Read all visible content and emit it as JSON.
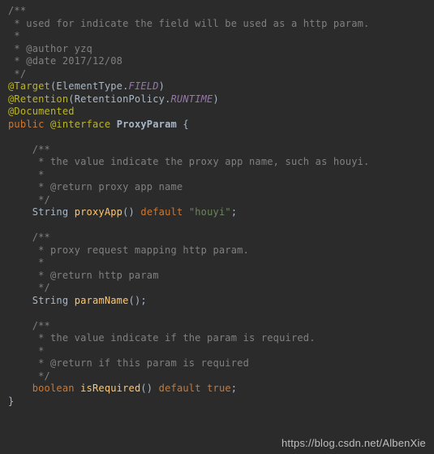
{
  "doc": {
    "start": "/**",
    "l1": " * used for indicate the field will be used as a http param.",
    "l2": " *",
    "l3": " * @author yzq",
    "l4": " * @date 2017/12/08",
    "end": " */"
  },
  "anno": {
    "target": "@Target",
    "target_paren_open": "(",
    "target_class": "ElementType",
    "target_dot": ".",
    "target_const": "FIELD",
    "target_paren_close": ")",
    "retention": "@Retention",
    "retention_paren_open": "(",
    "retention_class": "RetentionPolicy",
    "retention_dot": ".",
    "retention_const": "RUNTIME",
    "retention_paren_close": ")",
    "documented": "@Documented"
  },
  "decl": {
    "public": "public",
    "iface_kw": "@interface",
    "name": "ProxyParam",
    "open": "{",
    "close": "}"
  },
  "proxyApp": {
    "d0": "/**",
    "d1": " * the value indicate the proxy app name, such as houyi.",
    "d2": " *",
    "d3": " * @return proxy app name",
    "d4": " */",
    "type": "String",
    "name": "proxyApp",
    "parens": "()",
    "default_kw": "default",
    "value": "\"houyi\"",
    "semi": ";"
  },
  "paramName": {
    "d0": "/**",
    "d1": " * proxy request mapping http param.",
    "d2": " *",
    "d3": " * @return http param",
    "d4": " */",
    "type": "String",
    "name": "paramName",
    "parens": "()",
    "semi": ";"
  },
  "isRequired": {
    "d0": "/**",
    "d1": " * the value indicate if the param is required.",
    "d2": " *",
    "d3": " * @return if this param is required",
    "d4": " */",
    "type": "boolean",
    "name": "isRequired",
    "parens": "()",
    "default_kw": "default",
    "value": "true",
    "semi": ";"
  },
  "watermark": "https://blog.csdn.net/AlbenXie"
}
